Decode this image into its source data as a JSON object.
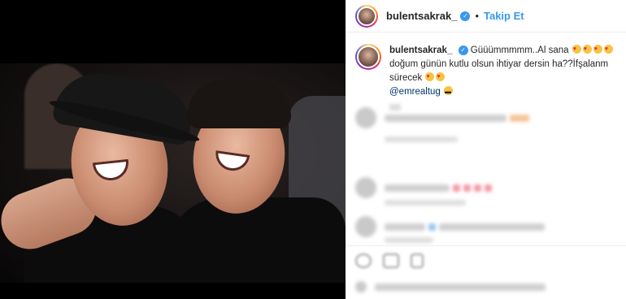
{
  "post": {
    "username": "bulentsakrak_",
    "follow_label": "Takip Et",
    "separator": "•"
  },
  "caption": {
    "username": "bulentsakrak_",
    "text_part1": "Güüümmmmm..Al sana",
    "text_part2": "doğum günün kutlu olsun ihtiyar dersin ha??İfşalanm sürecek",
    "mention": "@emrealtug"
  },
  "colors": {
    "accent": "#3897f0",
    "mention": "#00376b",
    "verified": "#3897f0"
  },
  "icons": [
    "verified-badge-icon",
    "heart-eyes-emoji",
    "sunglasses-emoji",
    "like-icon",
    "comment-icon",
    "share-icon"
  ]
}
